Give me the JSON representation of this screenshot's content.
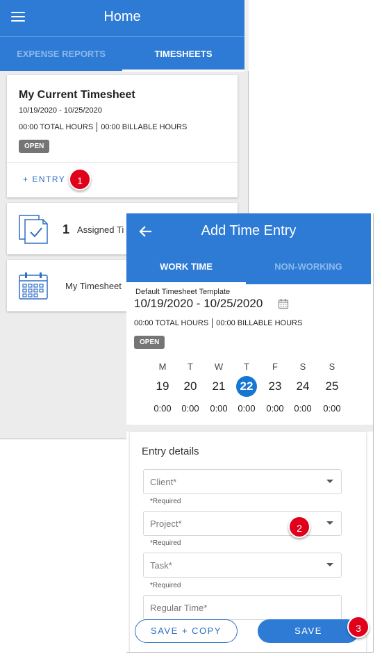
{
  "home": {
    "title": "Home",
    "tabs": [
      {
        "label": "EXPENSE REPORTS",
        "active": false
      },
      {
        "label": "TIMESHEETS",
        "active": true
      }
    ],
    "current_timesheet": {
      "title": "My Current Timesheet",
      "date_range": "10/19/2020 - 10/25/2020",
      "total_hours": "00:00 TOTAL HOURS",
      "billable_hours": "00:00 BILLABLE HOURS",
      "status": "OPEN",
      "entry_button": "+ ENTRY"
    },
    "assigned": {
      "count": "1",
      "label": "Assigned Ti",
      "icon": "approval-documents-icon"
    },
    "my_timesheets": {
      "label": "My Timesheet",
      "icon": "calendar-icon"
    }
  },
  "add_entry": {
    "title": "Add Time Entry",
    "tabs": [
      {
        "label": "WORK TIME",
        "active": true
      },
      {
        "label": "NON-WORKING",
        "active": false
      }
    ],
    "template_label": "Default Timesheet Template",
    "date_range": "10/19/2020 - 10/25/2020",
    "total_hours": "00:00 TOTAL HOURS",
    "billable_hours": "00:00 BILLABLE HOURS",
    "status": "OPEN",
    "days": [
      {
        "letter": "M",
        "num": "19",
        "hours": "0:00",
        "selected": false
      },
      {
        "letter": "T",
        "num": "20",
        "hours": "0:00",
        "selected": false
      },
      {
        "letter": "W",
        "num": "21",
        "hours": "0:00",
        "selected": false
      },
      {
        "letter": "T",
        "num": "22",
        "hours": "0:00",
        "selected": true
      },
      {
        "letter": "F",
        "num": "23",
        "hours": "0:00",
        "selected": false
      },
      {
        "letter": "S",
        "num": "24",
        "hours": "0:00",
        "selected": false
      },
      {
        "letter": "S",
        "num": "25",
        "hours": "0:00",
        "selected": false
      }
    ],
    "entry_details": {
      "title": "Entry details",
      "fields": [
        {
          "placeholder": "Client*",
          "helper": "*Required",
          "dropdown": true
        },
        {
          "placeholder": "Project*",
          "helper": "*Required",
          "dropdown": true
        },
        {
          "placeholder": "Task*",
          "helper": "*Required",
          "dropdown": true
        },
        {
          "placeholder": "Regular Time*",
          "helper": "",
          "dropdown": false
        }
      ]
    },
    "buttons": {
      "save_copy": "SAVE + COPY",
      "save": "SAVE"
    }
  },
  "callouts": [
    "1",
    "2",
    "3"
  ],
  "colors": {
    "primary": "#2e7bd6",
    "callout": "#e0001b",
    "badge": "#757575",
    "selected_day": "#1677d2"
  }
}
